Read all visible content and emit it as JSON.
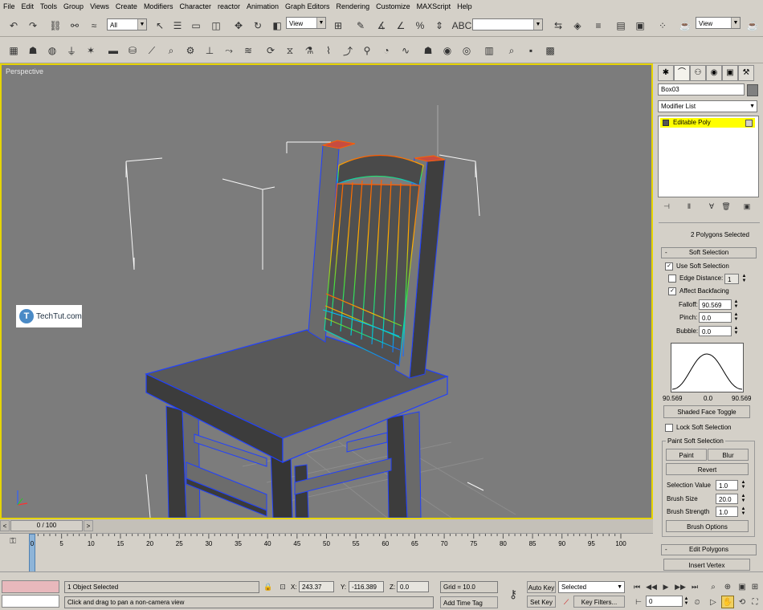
{
  "menu": [
    "File",
    "Edit",
    "Tools",
    "Group",
    "Views",
    "Create",
    "Modifiers",
    "Character",
    "reactor",
    "Animation",
    "Graph Editors",
    "Rendering",
    "Customize",
    "MAXScript",
    "Help"
  ],
  "toolbar": {
    "selection_filter": "All",
    "ref_coord": "View",
    "named_sel": "",
    "ref_coord2": "View"
  },
  "viewport": {
    "label": "Perspective",
    "watermark_text": "TechTut.com",
    "watermark_logo": "T"
  },
  "panel": {
    "object_name": "Box03",
    "object_color": "#808080",
    "modifier_list_label": "Modifier List",
    "stack_item": "Editable Poly",
    "stack_highlight_color": "#ffff00",
    "selection_info": "2 Polygons Selected",
    "soft_selection": {
      "title": "Soft Selection",
      "use_soft_selection": "Use Soft Selection",
      "edge_distance": "Edge Distance:",
      "edge_distance_value": "1",
      "affect_backfacing": "Affect Backfacing",
      "falloff_label": "Falloff:",
      "falloff_value": "90.569",
      "pinch_label": "Pinch:",
      "pinch_value": "0.0",
      "bubble_label": "Bubble:",
      "bubble_value": "0.0",
      "curve_left": "90.569",
      "curve_mid": "0.0",
      "curve_right": "90.569",
      "shaded_face_toggle": "Shaded Face Toggle",
      "lock_soft_selection": "Lock Soft Selection",
      "paint_group": "Paint Soft Selection",
      "paint": "Paint",
      "blur": "Blur",
      "revert": "Revert",
      "selection_value_label": "Selection Value",
      "selection_value": "1.0",
      "brush_size_label": "Brush Size",
      "brush_size": "20.0",
      "brush_strength_label": "Brush Strength",
      "brush_strength": "1.0",
      "brush_options": "Brush Options"
    },
    "edit_polygons": {
      "title": "Edit Polygons",
      "insert_vertex": "Insert Vertex"
    }
  },
  "timeline": {
    "slider_label": "0 / 100",
    "ticks": [
      "0",
      "5",
      "10",
      "15",
      "20",
      "25",
      "30",
      "35",
      "40",
      "45",
      "50",
      "55",
      "60",
      "65",
      "70",
      "75",
      "80",
      "85",
      "90",
      "95",
      "100"
    ]
  },
  "status": {
    "objects_selected": "1 Object Selected",
    "prompt": "Click and drag to pan a non-camera view",
    "x_label": "X:",
    "x_value": "243.37",
    "y_label": "Y:",
    "y_value": "-116.389",
    "z_label": "Z:",
    "z_value": "0.0",
    "grid": "Grid = 10.0",
    "add_time_tag": "Add Time Tag",
    "auto_key": "Auto Key",
    "set_key": "Set Key",
    "selected_dropdown": "Selected",
    "key_filters": "Key Filters...",
    "current_frame": "0"
  }
}
